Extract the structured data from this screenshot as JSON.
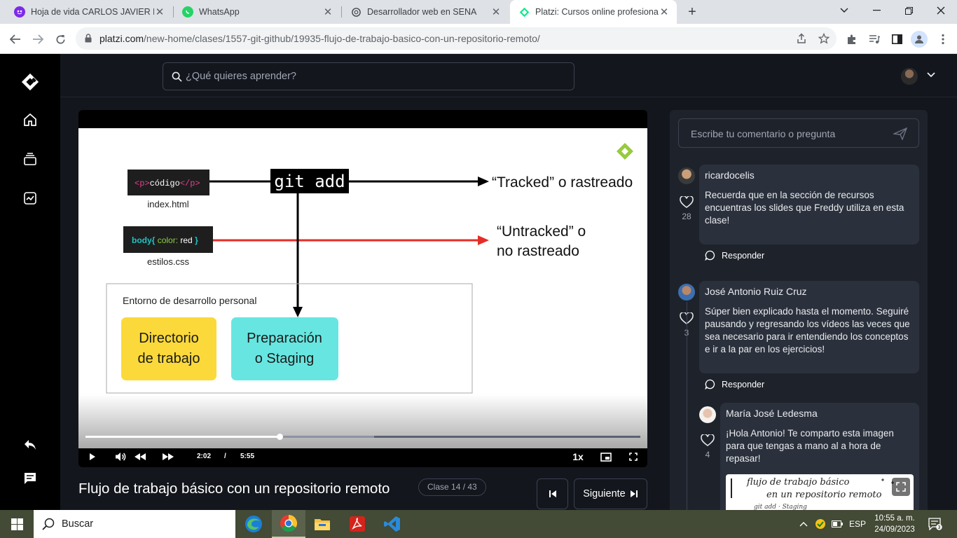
{
  "browser": {
    "tabs": [
      {
        "label": "Hoja de vida CARLOS JAVIER LO",
        "icon": "canva-icon",
        "active": false
      },
      {
        "label": "WhatsApp",
        "icon": "whatsapp-icon",
        "active": false
      },
      {
        "label": "Desarrollador web en SENA",
        "icon": "chatgpt-icon",
        "active": false
      },
      {
        "label": "Platzi: Cursos online profesional",
        "icon": "platzi-icon",
        "active": true
      }
    ],
    "url_host": "platzi.com",
    "url_path": "/new-home/clases/1557-git-github/19935-flujo-de-trabajo-basico-con-un-repositorio-remoto/"
  },
  "app": {
    "search_placeholder": "¿Qué quieres aprender?"
  },
  "slide": {
    "code1": {
      "open": "<p>",
      "text": "código",
      "close": "</p>"
    },
    "file1": "index.html",
    "git_add": "git add",
    "tracked": "“Tracked” o rastreado",
    "code2": {
      "sel": "body{",
      "prop": "color:",
      "val": "red",
      "close": "}"
    },
    "file2": "estilos.css",
    "untracked_1": "“Untracked” o",
    "untracked_2": "no rastreado",
    "env_label": "Entorno de desarrollo personal",
    "box1_1": "Directorio",
    "box1_2": "de trabajo",
    "box2_1": "Preparación",
    "box2_2": "o Staging"
  },
  "player": {
    "current_time": "2:02",
    "separator": "/",
    "duration": "5:55",
    "speed": "1x",
    "played_fraction": 0.35,
    "buffered_fraction": 0.52
  },
  "lesson": {
    "title": "Flujo de trabajo básico con un repositorio remoto",
    "clase": "Clase 14 / 43",
    "next_label": "Siguiente"
  },
  "comments": {
    "input_placeholder": "Escribe tu comentario o pregunta",
    "reply_label": "Responder",
    "items": [
      {
        "user": "ricardocelis",
        "text": "Recuerda que en la sección de recursos encuentras los slides que Freddy utiliza en esta clase!",
        "likes": "28"
      },
      {
        "user": "José Antonio Ruiz Cruz",
        "text": "Súper bien explicado hasta el momento. Seguiré pausando y regresando los vídeos las veces que sea necesario para ir entendiendo los conceptos e ir a la par en los ejercicios!",
        "likes": "3"
      },
      {
        "user": "María José Ledesma",
        "text": "¡Hola Antonio! Te comparto esta imagen para que tengas a mano al a hora de repasar!",
        "likes": "4"
      }
    ],
    "image_text": {
      "line1": "flujo de trabajo básico",
      "line2": "en un repositorio remoto",
      "line3": "git add · Staging"
    }
  },
  "taskbar": {
    "search_placeholder": "Buscar",
    "lang": "ESP",
    "time": "10:55 a. m.",
    "date": "24/09/2023",
    "notif_count": "3"
  }
}
